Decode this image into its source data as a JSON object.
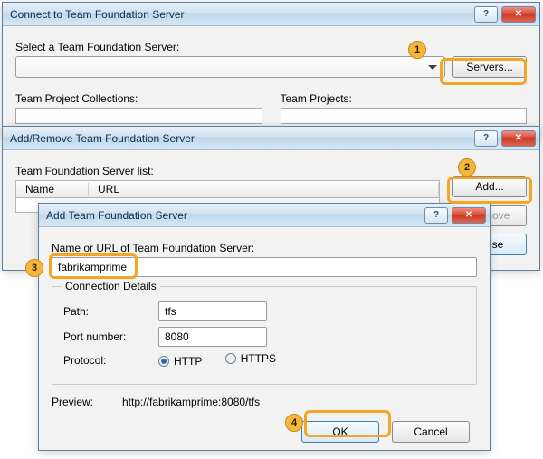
{
  "dialog1": {
    "title": "Connect to Team Foundation Server",
    "select_label": "Select a Team Foundation Server:",
    "servers_btn": "Servers...",
    "collections_label": "Team Project Collections:",
    "projects_label": "Team Projects:"
  },
  "dialog2": {
    "title": "Add/Remove Team Foundation Server",
    "list_label": "Team Foundation Server list:",
    "col_name": "Name",
    "col_url": "URL",
    "add_btn": "Add...",
    "remove_btn": "Remove",
    "close_btn": "Close"
  },
  "dialog3": {
    "title": "Add Team Foundation Server",
    "name_label": "Name or URL of Team Foundation Server:",
    "name_value": "fabrikamprime",
    "group_title": "Connection Details",
    "path_label": "Path:",
    "path_value": "tfs",
    "port_label": "Port number:",
    "port_value": "8080",
    "protocol_label": "Protocol:",
    "protocol_http": "HTTP",
    "protocol_https": "HTTPS",
    "preview_label": "Preview:",
    "preview_value": "http://fabrikamprime:8080/tfs",
    "ok_btn": "OK",
    "cancel_btn": "Cancel"
  },
  "callouts": {
    "c1": "1",
    "c2": "2",
    "c3": "3",
    "c4": "4"
  },
  "glyphs": {
    "help": "?",
    "close": "✕"
  }
}
